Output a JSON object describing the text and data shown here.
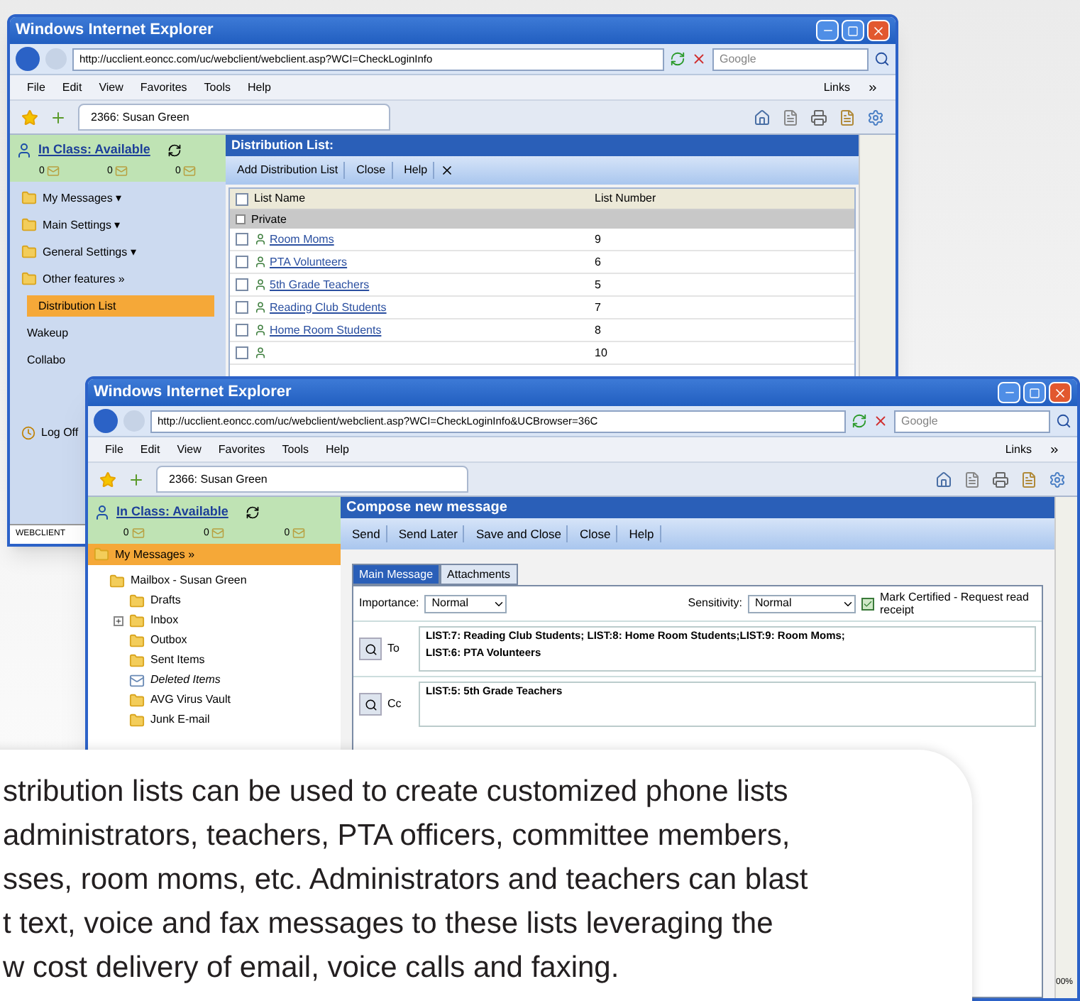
{
  "back_window": {
    "title": "Windows Internet Explorer",
    "address": "http://ucclient.eoncc.com/uc/webclient/webclient.asp?WCI=CheckLoginInfo",
    "search_placeholder": "Google",
    "menu": [
      "File",
      "Edit",
      "View",
      "Favorites",
      "Tools",
      "Help"
    ],
    "links": "Links",
    "tab": "2366: Susan Green",
    "status": "In Class: Available",
    "counts": [
      "0",
      "0",
      "0"
    ],
    "nav": [
      {
        "label": "My Messages ▾",
        "kind": "section",
        "selected": false
      },
      {
        "label": "Main Settings ▾",
        "kind": "section",
        "selected": false
      },
      {
        "label": "General Settings ▾",
        "kind": "section",
        "selected": false
      },
      {
        "label": "Other features »",
        "kind": "section",
        "selected": false
      },
      {
        "label": "Distribution List",
        "kind": "link",
        "selected": true
      },
      {
        "label": "Wakeup",
        "kind": "link",
        "selected": false
      },
      {
        "label": "Collabo",
        "kind": "link",
        "selected": false
      }
    ],
    "logoff": "Log Off",
    "status_bar": "WEBCLIENT",
    "panel_title": "Distribution List:",
    "toolbar": [
      "Add Distribution List",
      "Close",
      "Help"
    ],
    "select_all_checked": false,
    "columns": [
      "List Name",
      "List Number"
    ],
    "group": "Private",
    "rows": [
      {
        "name": "Room Moms",
        "number": "9",
        "checked": false
      },
      {
        "name": "PTA Volunteers",
        "number": "6",
        "checked": false
      },
      {
        "name": "5th Grade Teachers",
        "number": "5",
        "checked": false
      },
      {
        "name": "Reading Club Students",
        "number": "7",
        "checked": false
      },
      {
        "name": "Home Room Students",
        "number": "8",
        "checked": false
      },
      {
        "number": "10",
        "checked": false
      }
    ]
  },
  "front_window": {
    "title": "Windows Internet Explorer",
    "address": "http://ucclient.eoncc.com/uc/webclient/webclient.asp?WCI=CheckLoginInfo&UCBrowser=36C",
    "search_placeholder": "Google",
    "menu": [
      "File",
      "Edit",
      "View",
      "Favorites",
      "Tools",
      "Help"
    ],
    "links": "Links",
    "tab": "2366: Susan Green",
    "status": "In Class: Available",
    "counts": [
      "0",
      "0",
      "0"
    ],
    "nav_selected": {
      "label": "My Messages »",
      "selected": true
    },
    "tree": [
      {
        "label": "Mailbox - Susan Green",
        "expanded": true,
        "children": [
          {
            "label": "Drafts"
          },
          {
            "label": "Inbox",
            "expanded": false
          },
          {
            "label": "Outbox"
          },
          {
            "label": "Sent Items"
          },
          {
            "label": "Deleted Items",
            "kind": "trash"
          },
          {
            "label": "AVG Virus Vault"
          },
          {
            "label": "Junk E-mail"
          }
        ]
      }
    ],
    "panel_title": "Compose new message",
    "toolbar": [
      "Send",
      "Send Later",
      "Save and Close",
      "Close",
      "Help"
    ],
    "tabs": [
      {
        "label": "Main Message",
        "selected": true
      },
      {
        "label": "Attachments",
        "selected": false
      }
    ],
    "importance_label": "Importance:",
    "importance": "Normal",
    "sensitivity_label": "Sensitivity:",
    "sensitivity": "Normal",
    "certified": {
      "label": "Mark Certified - Request read receipt",
      "checked": true
    },
    "to_label": "To",
    "to": [
      "LIST:7: Reading Club Students; LIST:8: Home Room Students;LIST:9: Room Moms;",
      "LIST:6: PTA Volunteers"
    ],
    "cc_label": "Cc",
    "cc": [
      "LIST:5: 5th Grade Teachers"
    ],
    "zoom": "00%"
  },
  "callout": {
    "lines": [
      "stribution lists can be used to create customized phone lists",
      "administrators, teachers, PTA officers, committee members,",
      "sses, room moms, etc. Administrators and teachers can blast",
      "t text, voice and fax messages to these lists leveraging the",
      "w cost delivery of email, voice calls and faxing."
    ]
  }
}
